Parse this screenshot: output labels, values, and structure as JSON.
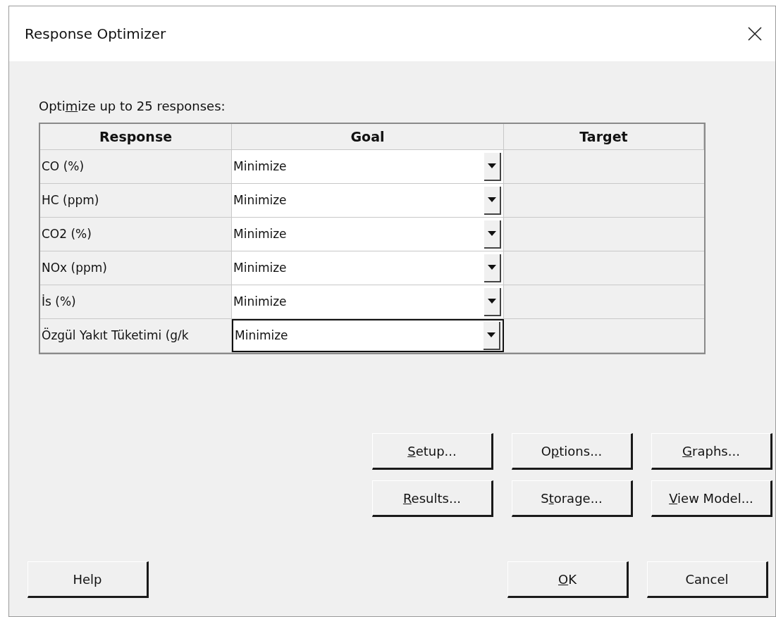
{
  "window": {
    "title": "Response Optimizer"
  },
  "prompt": {
    "before": "Opti",
    "mnemonic": "m",
    "after": "ize up to 25 responses:"
  },
  "table": {
    "columns": [
      "Response",
      "Goal",
      "Target"
    ],
    "rows": [
      {
        "response": "CO (%)",
        "goal": "Minimize",
        "focused": false
      },
      {
        "response": "HC (ppm)",
        "goal": "Minimize",
        "focused": false
      },
      {
        "response": "CO2 (%)",
        "goal": "Minimize",
        "focused": false
      },
      {
        "response": "NOx (ppm)",
        "goal": "Minimize",
        "focused": false
      },
      {
        "response": "İs (%)",
        "goal": "Minimize",
        "focused": false
      },
      {
        "response": "Özgül Yakıt Tüketimi (g/k",
        "goal": "Minimize",
        "focused": true
      }
    ]
  },
  "option_buttons": [
    [
      {
        "mnemonic": "S",
        "after": "etup..."
      },
      {
        "before": "O",
        "mnemonic": "p",
        "after": "tions..."
      },
      {
        "mnemonic": "G",
        "after": "raphs..."
      }
    ],
    [
      {
        "mnemonic": "R",
        "after": "esults..."
      },
      {
        "before": "S",
        "mnemonic": "t",
        "after": "orage..."
      },
      {
        "mnemonic": "V",
        "after": "iew Model..."
      }
    ]
  ],
  "help_button": {
    "before": "Help"
  },
  "footer_buttons": [
    {
      "mnemonic": "O",
      "after": "K"
    },
    {
      "before": "Cancel"
    }
  ]
}
